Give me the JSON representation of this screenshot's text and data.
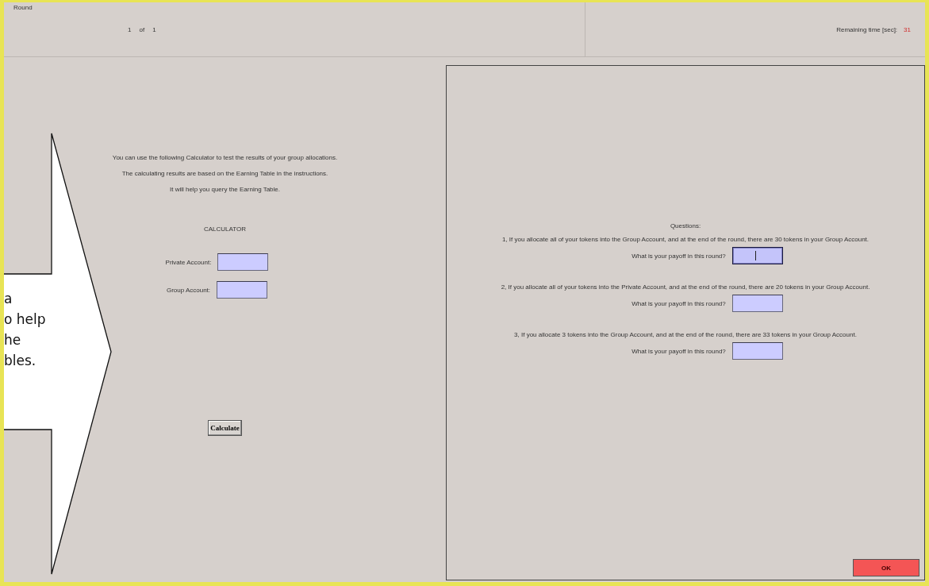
{
  "header": {
    "title": "Round",
    "round": {
      "current": "1",
      "of": "of",
      "total": "1"
    },
    "timer": {
      "label": "Remaining time [sec]:",
      "value": "31"
    }
  },
  "calculator": {
    "intro": [
      "You can use the following Calculator to test the results of your group allocations.",
      "The calculating results are based on the Earning Table in the instructions.",
      "It will help you query the Earning Table."
    ],
    "title": "CALCULATOR",
    "fields": [
      {
        "label": "Private Account:"
      },
      {
        "label": "Group Account:"
      }
    ],
    "button": "Calculate"
  },
  "questions": {
    "title": "Questions:",
    "items": [
      {
        "text": "1, If you allocate all of your tokens into the Group Account, and at the end of the round, there are 30 tokens in your Group Account.",
        "prompt": "What is your payoff in this round?",
        "focused": true
      },
      {
        "text": "2, If you allocate all of your tokens into the Private Account, and at the end of the round, there are 20 tokens in your Group Account.",
        "prompt": "What is your payoff in this round?",
        "focused": false
      },
      {
        "text": "3, If you allocate 3 tokens into the Group Account, and at the end of the round, there are 33 tokens in your Group Account.",
        "prompt": "What is your payoff in this round?",
        "focused": false
      }
    ]
  },
  "ok_button": "OK",
  "callout": {
    "lines": [
      "a",
      "o help",
      "he",
      "bles."
    ]
  }
}
